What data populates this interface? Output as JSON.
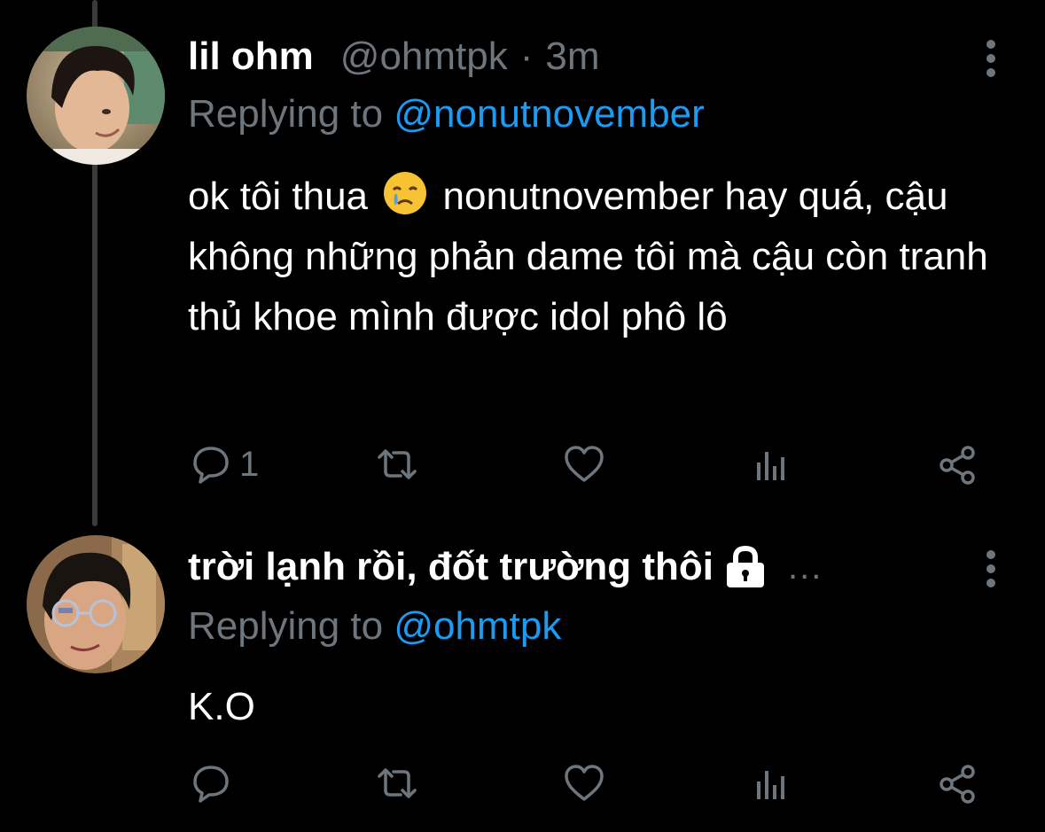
{
  "tweets": [
    {
      "display_name": "lil ohm",
      "handle": "@ohmtpk",
      "separator": "·",
      "time": "3m",
      "replying_prefix": "Replying to",
      "replying_to": "@nonutnovember",
      "text_before_emoji": "ok tôi thua",
      "emoji": "crying-face",
      "text_after_emoji": "nonutnovember hay quá, cậu không những phản dame tôi mà cậu còn tranh thủ khoe mình được idol phô lô",
      "reply_count": "1",
      "retweet_count": "",
      "like_count": ""
    },
    {
      "display_name": "trời lạnh rồi, đốt trường thôi",
      "protected": true,
      "truncated_marker": "...",
      "replying_prefix": "Replying to",
      "replying_to": "@ohmtpk",
      "text": "K.O",
      "reply_count": "",
      "retweet_count": "",
      "like_count": ""
    }
  ],
  "icons": {
    "reply": "reply-icon",
    "retweet": "retweet-icon",
    "like": "heart-icon",
    "analytics": "analytics-icon",
    "share": "share-icon",
    "more": "more-vertical-icon",
    "lock": "lock-icon"
  },
  "colors": {
    "background": "#000000",
    "text_primary": "#ffffff",
    "text_secondary": "#6e767d",
    "accent": "#1d9bf0",
    "thread_line": "#3a3a3a"
  }
}
